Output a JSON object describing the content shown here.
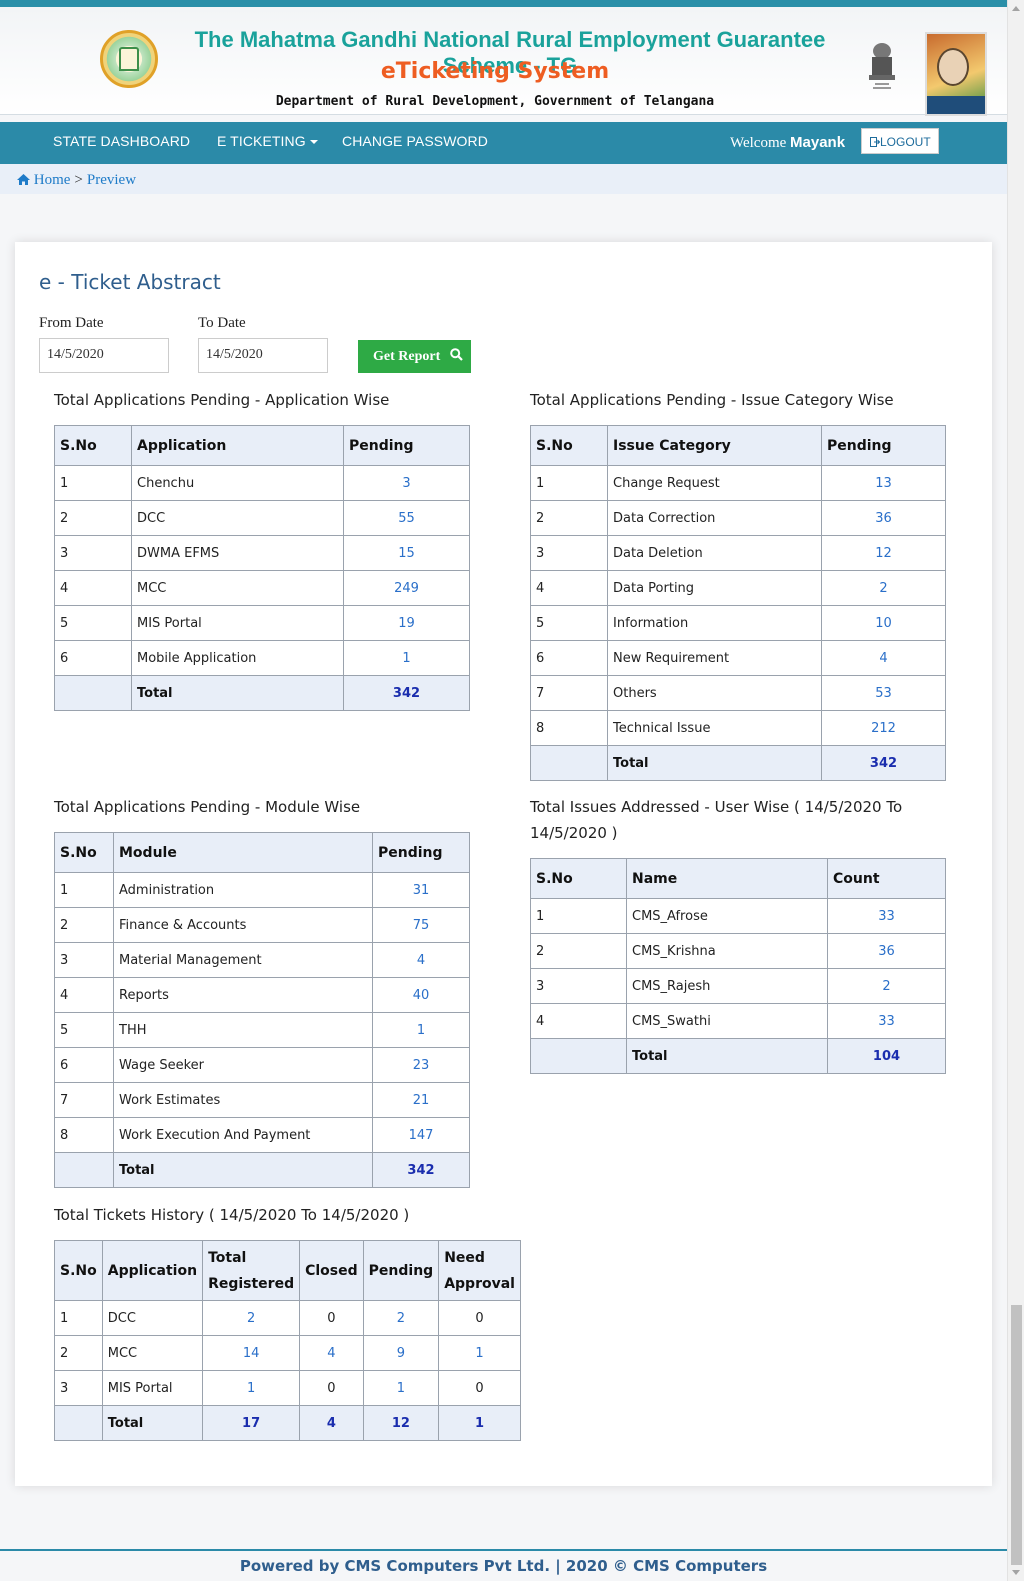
{
  "header": {
    "title": "The Mahatma Gandhi National Rural Employment Guarantee Scheme - TG",
    "subtitle": "eTicketing System",
    "department": "Department of Rural Development, Government of Telangana"
  },
  "nav": {
    "items": [
      {
        "label": "STATE DASHBOARD"
      },
      {
        "label": "E TICKETING"
      },
      {
        "label": "CHANGE PASSWORD"
      }
    ],
    "welcome_label": "Welcome",
    "user_name": "Mayank",
    "logout_label": "LOGOUT"
  },
  "breadcrumb": {
    "home": "Home",
    "separator": ">",
    "current": "Preview"
  },
  "report": {
    "title": "e - Ticket Abstract",
    "from_label": "From Date",
    "from_value": "14/5/2020",
    "to_label": "To Date",
    "to_value": "14/5/2020",
    "button_label": "Get Report"
  },
  "app_wise": {
    "title": "Total Applications Pending - Application Wise",
    "headers": [
      "S.No",
      "Application",
      "Pending"
    ],
    "rows": [
      [
        "1",
        "Chenchu",
        "3"
      ],
      [
        "2",
        "DCC",
        "55"
      ],
      [
        "3",
        "DWMA EFMS",
        "15"
      ],
      [
        "4",
        "MCC",
        "249"
      ],
      [
        "5",
        "MIS Portal",
        "19"
      ],
      [
        "6",
        "Mobile Application",
        "1"
      ]
    ],
    "total_label": "Total",
    "total": "342"
  },
  "issue_wise": {
    "title": "Total Applications Pending - Issue Category Wise",
    "headers": [
      "S.No",
      "Issue Category",
      "Pending"
    ],
    "rows": [
      [
        "1",
        "Change Request",
        "13"
      ],
      [
        "2",
        "Data Correction",
        "36"
      ],
      [
        "3",
        "Data Deletion",
        "12"
      ],
      [
        "4",
        "Data Porting",
        "2"
      ],
      [
        "5",
        "Information",
        "10"
      ],
      [
        "6",
        "New Requirement",
        "4"
      ],
      [
        "7",
        "Others",
        "53"
      ],
      [
        "8",
        "Technical Issue",
        "212"
      ]
    ],
    "total_label": "Total",
    "total": "342"
  },
  "module_wise": {
    "title": "Total Applications Pending - Module Wise",
    "headers": [
      "S.No",
      "Module",
      "Pending"
    ],
    "rows": [
      [
        "1",
        "Administration",
        "31"
      ],
      [
        "2",
        "Finance & Accounts",
        "75"
      ],
      [
        "3",
        "Material Management",
        "4"
      ],
      [
        "4",
        "Reports",
        "40"
      ],
      [
        "5",
        "THH",
        "1"
      ],
      [
        "6",
        "Wage Seeker",
        "23"
      ],
      [
        "7",
        "Work Estimates",
        "21"
      ],
      [
        "8",
        "Work Execution And Payment",
        "147"
      ]
    ],
    "total_label": "Total",
    "total": "342"
  },
  "user_wise": {
    "title": "Total Issues Addressed - User Wise ( 14/5/2020 To 14/5/2020 )",
    "headers": [
      "S.No",
      "Name",
      "Count"
    ],
    "rows": [
      [
        "1",
        "CMS_Afrose",
        "33"
      ],
      [
        "2",
        "CMS_Krishna",
        "36"
      ],
      [
        "3",
        "CMS_Rajesh",
        "2"
      ],
      [
        "4",
        "CMS_Swathi",
        "33"
      ]
    ],
    "total_label": "Total",
    "total": "104"
  },
  "history": {
    "title": "Total Tickets History ( 14/5/2020 To 14/5/2020 )",
    "headers": [
      "S.No",
      "Application",
      "Total Registered",
      "Closed",
      "Pending",
      "Need Approval"
    ],
    "rows": [
      [
        "1",
        "DCC",
        "2",
        "0",
        "2",
        "0"
      ],
      [
        "2",
        "MCC",
        "14",
        "4",
        "9",
        "1"
      ],
      [
        "3",
        "MIS Portal",
        "1",
        "0",
        "1",
        "0"
      ]
    ],
    "total_label": "Total",
    "totals": [
      "17",
      "4",
      "12",
      "1"
    ]
  },
  "footer": {
    "text": "Powered by CMS Computers Pvt Ltd. | 2020 © CMS Computers"
  },
  "colors": {
    "primary": "#2b8aa8",
    "title_teal": "#1aa29b",
    "title_orange": "#ee5d22",
    "link_blue": "#2a6fc9",
    "button_green": "#2eaa45"
  }
}
